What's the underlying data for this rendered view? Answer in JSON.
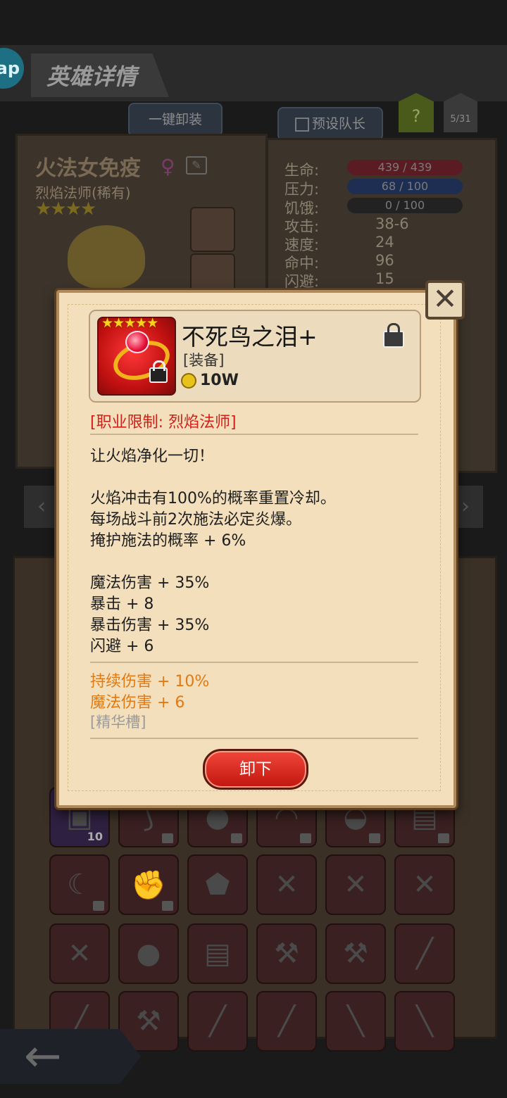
{
  "header": {
    "app_badge": "ap",
    "title": "英雄详情",
    "unequip_all_label": "一键卸装",
    "preset_captain_label": "预设队长",
    "help_label": "?",
    "hero_count": "5/31"
  },
  "hero": {
    "name": "火法女免疫",
    "gender_symbol": "♀",
    "class": "烈焰法师(稀有)",
    "stars": "★★★★"
  },
  "stats": {
    "life_label": "生命:",
    "life_value": "439 / 439",
    "stress_label": "压力:",
    "stress_value": "68 / 100",
    "hunger_label": "饥饿:",
    "hunger_value": "0 / 100",
    "attack_label": "攻击:",
    "attack_value": "38-6",
    "speed_label": "速度:",
    "speed_value": "24",
    "hit_label": "命中:",
    "hit_value": "96",
    "dodge_label": "闪避:",
    "dodge_value": "15"
  },
  "inventory": {
    "stack_count": "10"
  },
  "item": {
    "stars": "★★★★★",
    "name": "不死鸟之泪+",
    "type": "[装备]",
    "price": "10W",
    "restriction": "[职业限制: 烈焰法师]",
    "flavor": "让火焰净化一切！",
    "effects": [
      "火焰冲击有100%的概率重置冷却。",
      "每场战斗前2次施法必定炎爆。",
      "掩护施法的概率 + 6%"
    ],
    "stats": [
      "魔法伤害 + 35%",
      "暴击 + 8",
      "暴击伤害 + 35%",
      "闪避 + 6"
    ],
    "bonus": [
      "持续伤害 + 10%",
      "魔法伤害 + 6"
    ],
    "essence_slot": "[精华槽]",
    "unequip_label": "卸下"
  },
  "colors": {
    "popup_bg": "#f3dfbb",
    "restriction": "#d0201a",
    "bonus": "#e07a14",
    "button": "#d42a1e",
    "stars": "#ffd21a"
  }
}
